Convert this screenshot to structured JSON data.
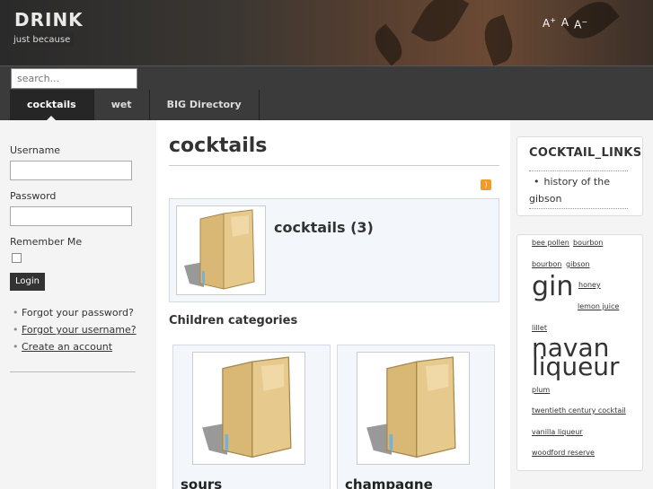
{
  "header": {
    "brand": "DRINK",
    "tagline": "just because",
    "font_controls": [
      "A",
      "A",
      "A"
    ]
  },
  "nav": {
    "search_placeholder": "search...",
    "tabs": [
      {
        "label": "cocktails",
        "active": true
      },
      {
        "label": "wet",
        "active": false
      },
      {
        "label": "BIG Directory",
        "active": false
      }
    ]
  },
  "login": {
    "username_label": "Username",
    "password_label": "Password",
    "remember_label": "Remember Me",
    "button_label": "Login",
    "links": [
      "Forgot your password?",
      "Forgot your username?",
      "Create an account"
    ]
  },
  "main": {
    "title": "cocktails",
    "category": "cocktails (3)",
    "children_heading": "Children categories",
    "children": [
      "sours",
      "champagne"
    ]
  },
  "right": {
    "links_module": {
      "title": "COCKTAIL_LINKS",
      "items": [
        "history of the gibson"
      ]
    },
    "tags": [
      {
        "label": "bee pollen"
      },
      {
        "label": "bourbon"
      },
      {
        "label": "bourbon"
      },
      {
        "label": "gibson"
      },
      {
        "label": "gin"
      },
      {
        "label": "honey"
      },
      {
        "label": "lemon juice"
      },
      {
        "label": "lillet"
      },
      {
        "label": "navan"
      },
      {
        "label": "liqueur"
      },
      {
        "label": "plum"
      },
      {
        "label": "twentieth century cocktail"
      },
      {
        "label": "vanilla liqueur"
      },
      {
        "label": "woodford reserve"
      }
    ]
  },
  "colors": {
    "nav_bg": "#3b3b3b",
    "active_tab": "#262626",
    "panel_bg": "#f3f6fa",
    "rss": "#f39a28"
  }
}
